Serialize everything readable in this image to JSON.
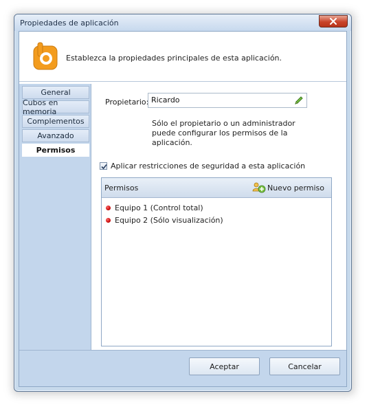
{
  "window": {
    "title": "Propiedades de aplicación",
    "close_icon": "close-icon"
  },
  "header": {
    "icon": "app-logo-icon",
    "description": "Establezca la propiedades principales de esta aplicación."
  },
  "sidebar": {
    "items": [
      {
        "label": "General",
        "active": false
      },
      {
        "label": "Cubos en memoria",
        "active": false
      },
      {
        "label": "Complementos",
        "active": false
      },
      {
        "label": "Avanzado",
        "active": false
      },
      {
        "label": "Permisos",
        "active": true
      }
    ]
  },
  "owner": {
    "label": "Propietario:",
    "value": "Ricardo",
    "edit_icon": "pencil-icon",
    "note": "Sólo el propietario o un administrador puede configurar los permisos de la aplicación."
  },
  "security": {
    "checked": true,
    "label": "Aplicar restricciones de seguridad a esta aplicación"
  },
  "permissions": {
    "title": "Permisos",
    "new_label": "Nuevo permiso",
    "new_icon": "add-permission-icon",
    "items": [
      {
        "label": "Equipo 1 (Control total)"
      },
      {
        "label": "Equipo 2 (Sólo visualización)"
      }
    ]
  },
  "footer": {
    "accept_label": "Aceptar",
    "cancel_label": "Cancelar"
  },
  "colors": {
    "accent_orange": "#f39c1e",
    "status_red": "#c00000",
    "frame_blue": "#c3d6ec"
  }
}
